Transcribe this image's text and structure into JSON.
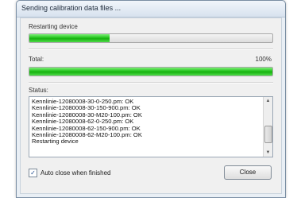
{
  "window": {
    "title": "Sending calibration data files ..."
  },
  "device_progress": {
    "label": "Restarting device",
    "value": 0.33
  },
  "total_progress": {
    "label": "Total:",
    "percent_text": "100%",
    "value": 1.0
  },
  "status": {
    "label": "Status:",
    "lines": [
      "Kennlinie-12080008-30-0-250.pm: OK",
      "Kennlinie-12080008-30-150-900.pm: OK",
      "Kennlinie-12080008-30-M20-100.pm: OK",
      "Kennlinie-12080008-62-0-250.pm: OK",
      "Kennlinie-12080008-62-150-900.pm: OK",
      "Kennlinie-12080008-62-M20-100.pm: OK",
      "Restarting device"
    ]
  },
  "auto_close": {
    "label": "Auto close when finished",
    "checked": true
  },
  "buttons": {
    "close_label": "Close"
  },
  "colors": {
    "progress_fill": "#22c31b",
    "window_frame": "#7a8ea3"
  },
  "icons": {
    "checkmark": "check-icon",
    "scroll_up": "scroll-up-icon",
    "scroll_down": "scroll-down-icon"
  }
}
